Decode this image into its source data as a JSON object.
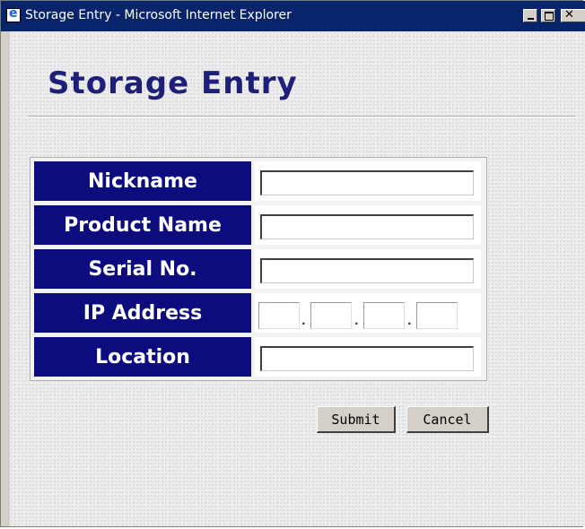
{
  "window": {
    "title": "Storage Entry - Microsoft Internet Explorer"
  },
  "page": {
    "heading": "Storage Entry"
  },
  "form": {
    "rows": [
      {
        "label": "Nickname",
        "value": ""
      },
      {
        "label": "Product Name",
        "value": ""
      },
      {
        "label": "Serial No.",
        "value": ""
      },
      {
        "label": "IP Address",
        "octets": [
          "",
          "",
          "",
          ""
        ],
        "separator": "."
      },
      {
        "label": "Location",
        "value": ""
      }
    ]
  },
  "buttons": {
    "submit_label": "Submit",
    "cancel_label": "Cancel"
  },
  "colors": {
    "title_bar": "#08246b",
    "heading": "#1d1f78",
    "label_bg": "#0c0c7e",
    "button_face": "#d4d0c8"
  }
}
